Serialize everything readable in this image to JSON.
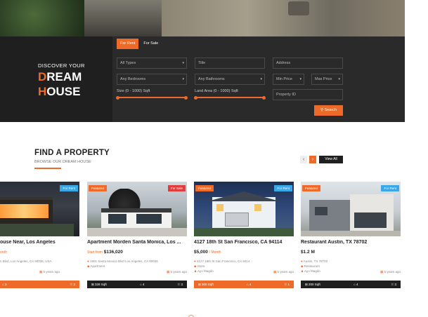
{
  "hero": {
    "discover": "DISCOVER YOUR",
    "dream_first": "D",
    "dream_rest": "REAM",
    "house_first": "H",
    "house_rest": "OUSE"
  },
  "search": {
    "tabs": [
      "For Rent",
      "For Sale"
    ],
    "type_select": "All Types",
    "title_field": "Title",
    "address_field": "Address",
    "bedroom_select": "Any Bedrooms",
    "bathroom_select": "Any Bathrooms",
    "min_price": "Min Price",
    "max_price": "Max Price",
    "size_label": "Size (0 - 1000) Sqft",
    "land_label": "Land Area (0 - 1000) Sqft",
    "property_id": "Property ID",
    "search_button": "Search"
  },
  "section": {
    "title": "FIND A PROPERTY",
    "subtitle": "BROWSE OUR DREAM HOUSE",
    "view_all": "View All"
  },
  "cards": [
    {
      "title": "ouse Near, Los Angeles",
      "price": "",
      "price_unit": "onth",
      "address": "n Blvd, Los Angeles, CA 90036, USA",
      "meta": "",
      "date": "5 years ago",
      "badge_left": "",
      "badge_right": "For Rent",
      "sqft": "",
      "beds": "3",
      "baths": "2",
      "bar": "orange"
    },
    {
      "title": "Apartment Morden Santa Monica, Los ...",
      "price": "$136,020",
      "price_prefix": "Start from",
      "address": "1901 Santa Monica Blvd Los Angeles, CA 90036",
      "meta": "Apartment",
      "date": "5 years ago",
      "badge_left": "Featured",
      "badge_right": "For Sale",
      "sqft": "328 Sqft",
      "beds": "4",
      "baths": "3",
      "bar": "dark"
    },
    {
      "title": "4127 18th St San Francisco, CA 94114",
      "price": "$5,000",
      "price_unit": "/ Month",
      "address": "4127 18th St San Francisco, CA 9414",
      "meta": "Store",
      "agent": "Ayo Magdo",
      "date": "5 years ago",
      "badge_left": "Featured",
      "badge_right": "For Rent",
      "sqft": "300 Sqft",
      "beds": "4",
      "baths": "1",
      "bar": "orange"
    },
    {
      "title": "Restaurant Austin, TX 78702",
      "price": "$1.2 M",
      "address": "Austin, TX 78702",
      "meta": "Restaurant",
      "agent": "Ayo Magdo",
      "date": "5 years ago",
      "badge_left": "Featured",
      "badge_right": "For Rent",
      "sqft": "200 Sqft",
      "beds": "4",
      "baths": "3",
      "bar": "dark"
    }
  ],
  "colors": {
    "accent": "#ee6a28",
    "dark": "#1f1f1f",
    "badge_blue": "#3aa7e6",
    "badge_red": "#e23b3b"
  }
}
